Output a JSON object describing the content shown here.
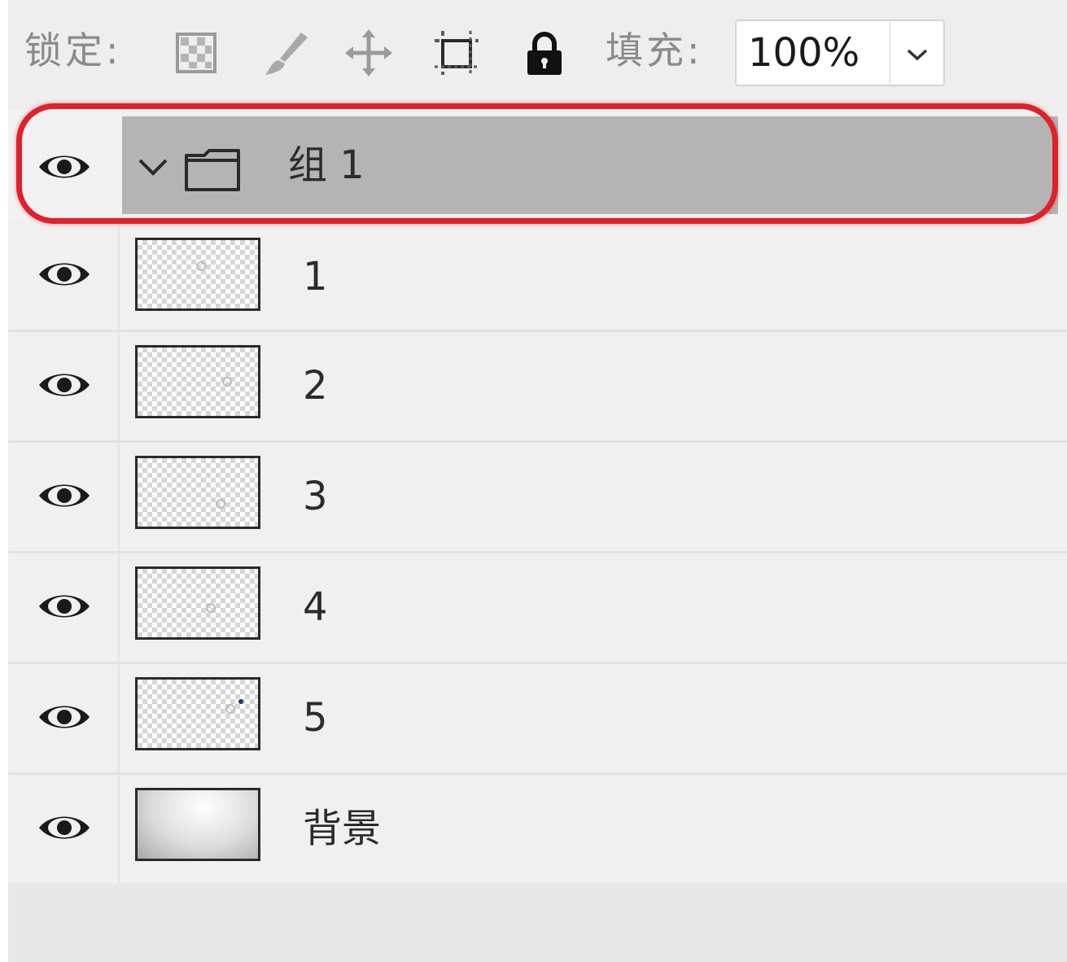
{
  "toolbar": {
    "lock_label": "锁定:",
    "fill_label": "填充:",
    "fill_value": "100%",
    "lock_icons": [
      "lock-transparent-pixels-icon",
      "lock-image-pixels-icon",
      "lock-position-icon",
      "lock-artboard-icon",
      "lock-all-icon"
    ]
  },
  "group": {
    "name": "组 1",
    "expanded": true,
    "selected": true,
    "highlight_color": "#e0202a"
  },
  "layers": [
    {
      "name": "1",
      "type": "transparent"
    },
    {
      "name": "2",
      "type": "transparent"
    },
    {
      "name": "3",
      "type": "transparent"
    },
    {
      "name": "4",
      "type": "transparent"
    },
    {
      "name": "5",
      "type": "transparent"
    },
    {
      "name": "背景",
      "type": "background"
    }
  ],
  "colors": {
    "panel_bg": "#eeeeee",
    "selected_row_bg": "#b4b4b4",
    "text": "#2b2b2b"
  }
}
